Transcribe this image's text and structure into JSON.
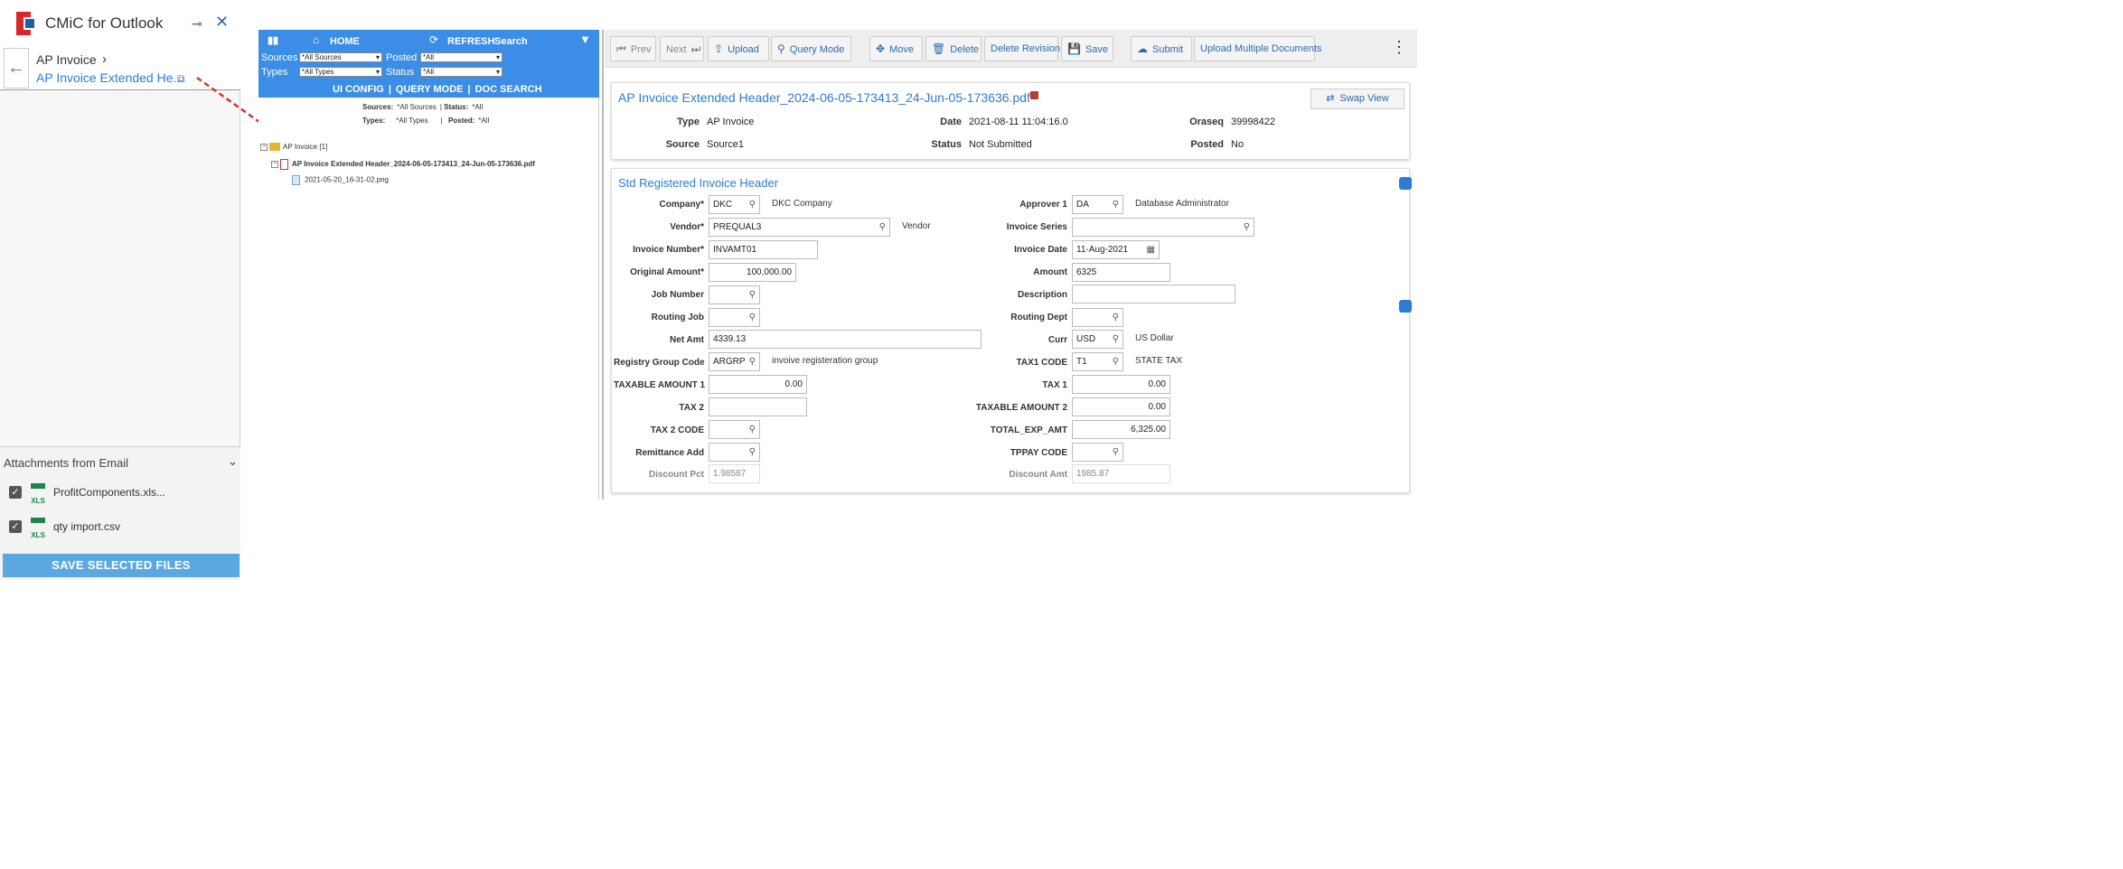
{
  "addin": {
    "title": "CMiC for Outlook",
    "pin_glyph": "⊸",
    "close_glyph": "✕",
    "breadcrumb": {
      "back_glyph": "←",
      "title": "AP Invoice",
      "chevron_glyph": "›",
      "document": "AP Invoice Extended He...",
      "open_glyph": "⧉"
    },
    "attachments": {
      "title": "Attachments from Email",
      "collapse_glyph": "⌄",
      "items": [
        {
          "name": "ProfitComponents.xls...",
          "icon": "XLS",
          "checked": true
        },
        {
          "name": "qty import.csv",
          "icon": "XLS",
          "checked": true
        }
      ],
      "save_label": "SAVE SELECTED FILES"
    }
  },
  "tree": {
    "toolbar": {
      "signal_glyph": "▮▮",
      "home_glyph": "⌂",
      "home": "HOME",
      "refresh_glyph": "⟳",
      "refresh": "REFRESH",
      "search": "Search",
      "funnel_glyph": "▼",
      "sources_label": "Sources",
      "sources_value": "*All Sources",
      "posted_label": "Posted",
      "posted_value": "*All",
      "types_label": "Types",
      "types_value": "*All Types",
      "status_label": "Status",
      "status_value": "*All",
      "links": [
        "UI CONFIG",
        "QUERY MODE",
        "DOC SEARCH"
      ]
    },
    "summary": {
      "sources_label": "Sources:",
      "sources_value": "*All Sources",
      "status_label": "Status:",
      "status_value": "*All",
      "types_label": "Types:",
      "types_value": "*All Types",
      "posted_label": "Posted:",
      "posted_value": "*All"
    },
    "folder": "AP Invoice",
    "folder_count": "[1]",
    "document": "AP Invoice Extended Header_2024-06-05-173413_24-Jun-05-173636.pdf",
    "attachment": "2021-05-20_16-31-02.png"
  },
  "toolbar": {
    "prev": "Prev",
    "next": "Next",
    "upload": "Upload",
    "query_mode": "Query Mode",
    "move": "Move",
    "delete": "Delete",
    "delete_revision": "Delete Revision",
    "save": "Save",
    "submit": "Submit",
    "upload_multiple": "Upload Multiple Documents",
    "kebab_glyph": "⋮"
  },
  "doc": {
    "title": "AP Invoice Extended Header_2024-06-05-173413_24-Jun-05-173636.pdf",
    "swap_view": "Swap View",
    "type_label": "Type",
    "type_value": "AP Invoice",
    "date_label": "Date",
    "date_value": "2021-08-11 11:04:16.0",
    "oraseq_label": "Oraseq",
    "oraseq_value": "39998422",
    "source_label": "Source",
    "source_value": "Source1",
    "status_label": "Status",
    "status_value": "Not Submitted",
    "posted_label": "Posted",
    "posted_value": "No"
  },
  "form": {
    "title": "Std Registered Invoice Header",
    "company_label": "Company*",
    "company_value": "DKC",
    "company_desc": "DKC Company",
    "vendor_label": "Vendor*",
    "vendor_value": "PREQUAL3",
    "vendor_desc": "Vendor",
    "invoice_number_label": "Invoice Number*",
    "invoice_number_value": "INVAMT01",
    "original_amount_label": "Original Amount*",
    "original_amount_value": "100,000.00",
    "job_number_label": "Job Number",
    "job_number_value": "",
    "routing_job_label": "Routing Job",
    "routing_job_value": "",
    "net_amt_label": "Net Amt",
    "net_amt_value": "4339.13",
    "registry_group_label": "Registry Group Code",
    "registry_group_value": "ARGRP",
    "registry_group_desc": "invoive registeration group",
    "taxable_amount1_label": "TAXABLE AMOUNT 1",
    "taxable_amount1_value": "0.00",
    "tax2_label": "TAX 2",
    "tax2_value": "",
    "tax2_code_label": "TAX 2 CODE",
    "tax2_code_value": "",
    "remittance_label": "Remittance Add",
    "remittance_value": "",
    "discount_pct_label": "Discount Pct",
    "discount_pct_value": "1.98587",
    "approver1_label": "Approver 1",
    "approver1_value": "DA",
    "approver1_desc": "Database Administrator",
    "invoice_series_label": "Invoice Series",
    "invoice_series_value": "",
    "invoice_date_label": "Invoice Date",
    "invoice_date_value": "11-Aug-2021",
    "amount_label": "Amount",
    "amount_value": "6325",
    "description_label": "Description",
    "description_value": "",
    "routing_dept_label": "Routing Dept",
    "routing_dept_value": "",
    "curr_label": "Curr",
    "curr_value": "USD",
    "curr_desc": "US Dollar",
    "tax1_code_label": "TAX1 CODE",
    "tax1_code_value": "T1",
    "tax1_code_desc": "STATE TAX",
    "tax1_label": "TAX 1",
    "tax1_value": "0.00",
    "taxable_amount2_label": "TAXABLE AMOUNT 2",
    "taxable_amount2_value": "0.00",
    "total_exp_label": "TOTAL_EXP_AMT",
    "total_exp_value": "6,325.00",
    "tppay_label": "TPPAY CODE",
    "tppay_value": "",
    "discount_amt_label": "Discount Amt",
    "discount_amt_value": "1985.87"
  }
}
